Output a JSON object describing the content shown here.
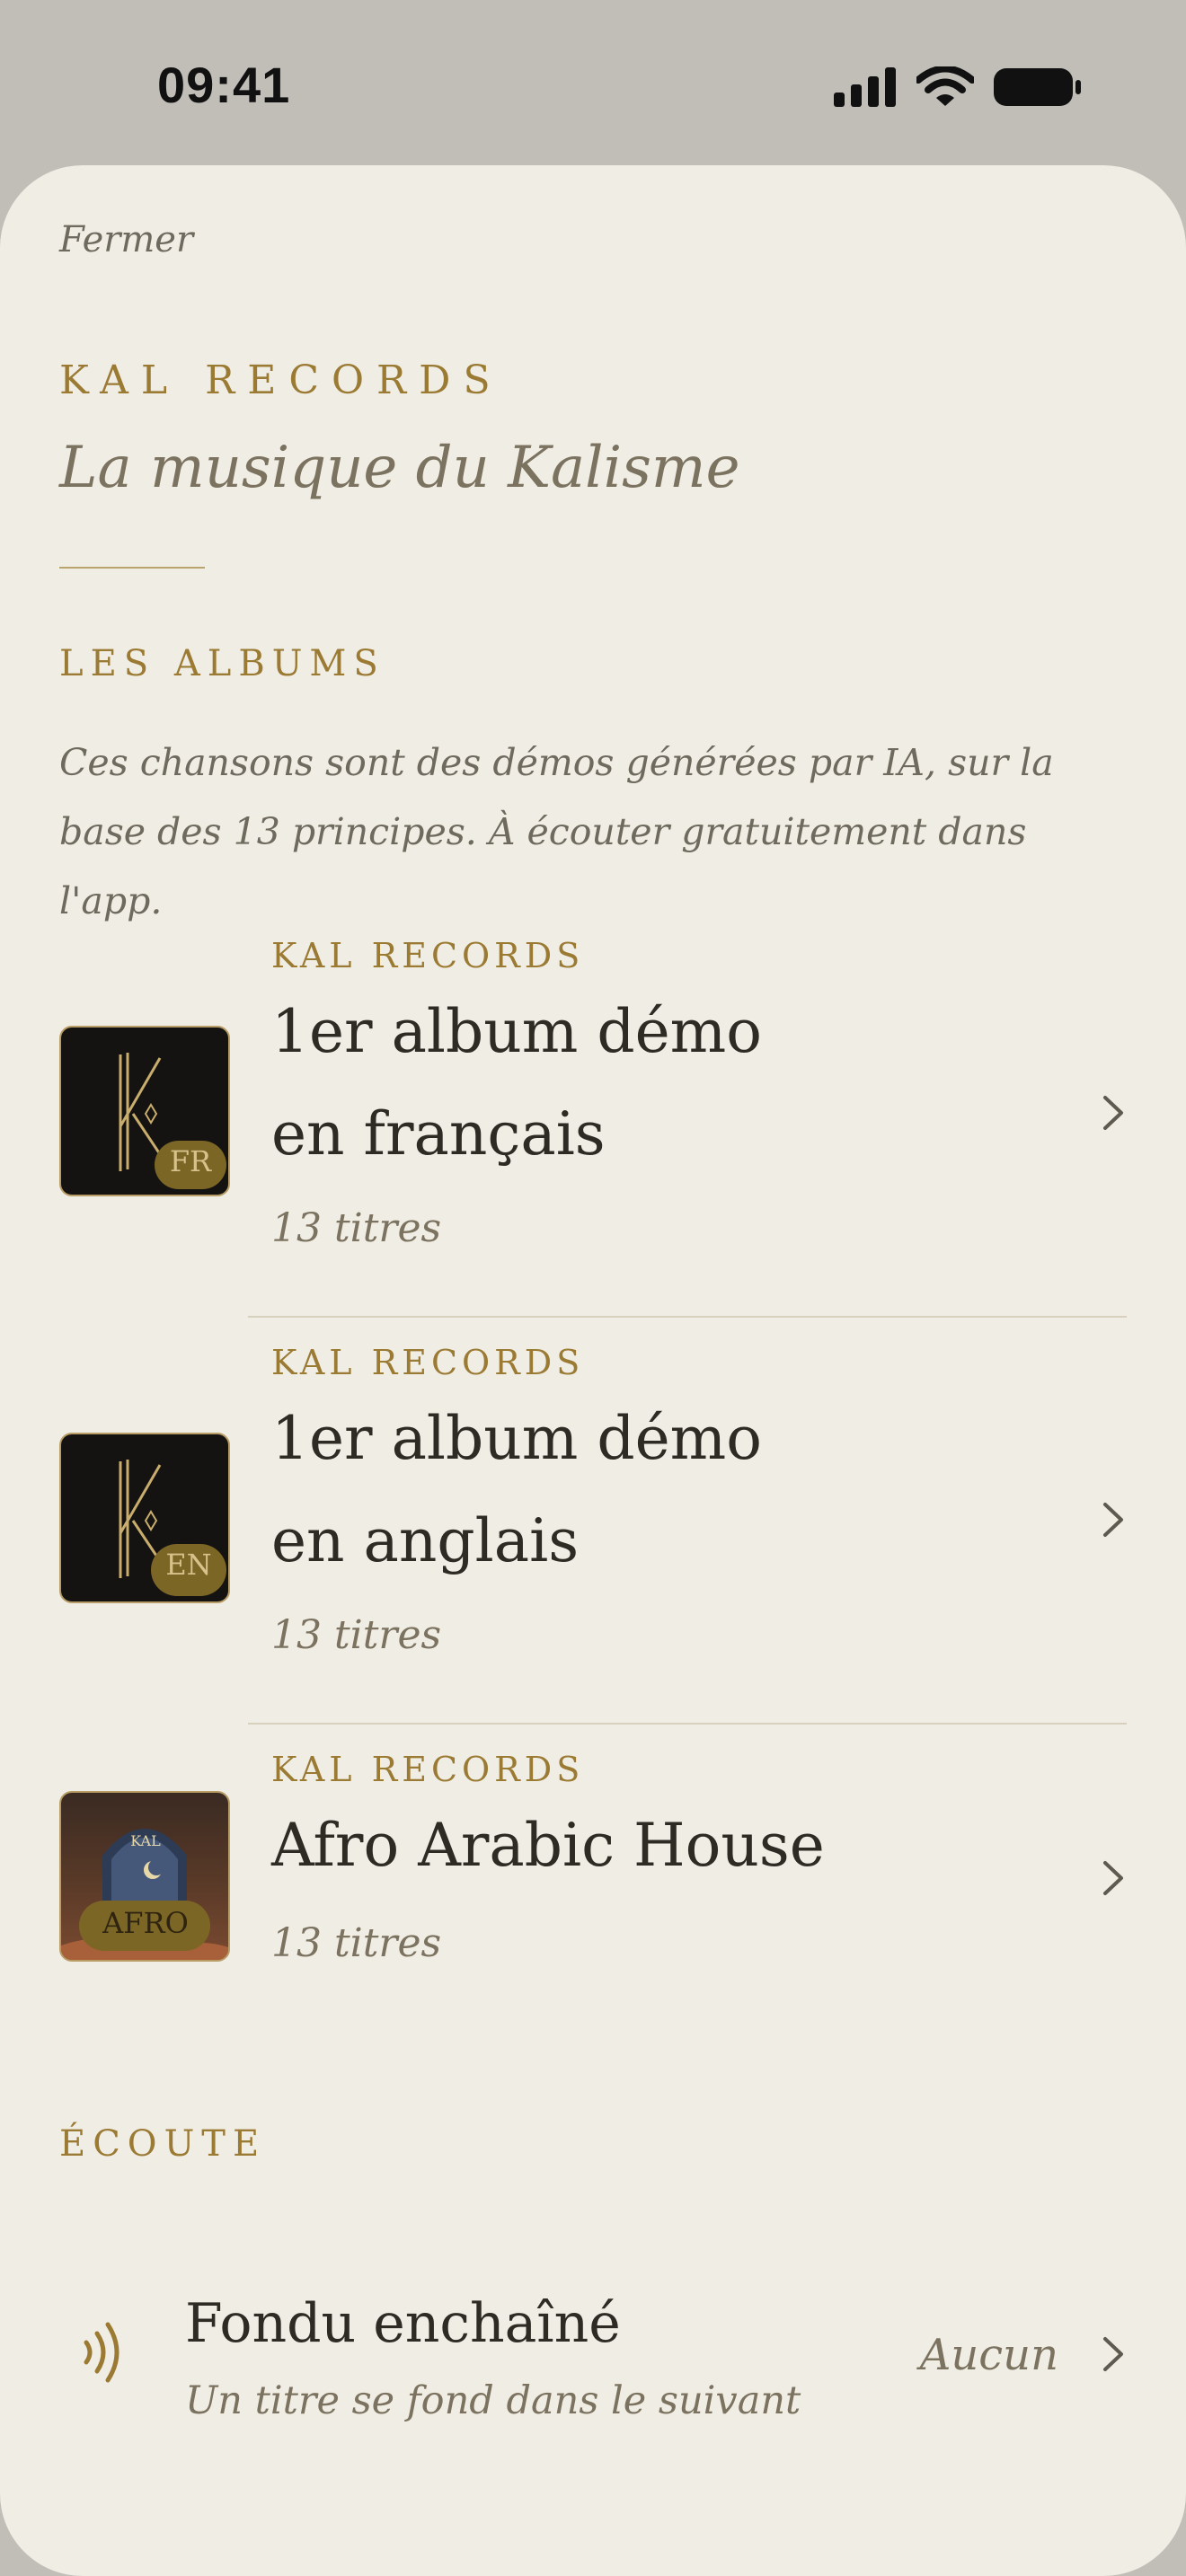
{
  "status_bar": {
    "time": "09:41"
  },
  "header": {
    "close_label": "Fermer",
    "brand": "KAL RECORDS",
    "subtitle": "La musique du Kalisme"
  },
  "albums_section": {
    "heading": "LES ALBUMS",
    "intro": "Ces chansons sont des démos générées par IA, sur la base des 13 principes. À écouter gratuitement dans l'app.",
    "albums": [
      {
        "label": "KAL RECORDS",
        "title_line1": "1er album démo",
        "title_line2": "en français",
        "count": "13 titres",
        "badge": "FR",
        "cover_mark": ""
      },
      {
        "label": "KAL RECORDS",
        "title_line1": "1er album démo",
        "title_line2": "en anglais",
        "count": "13 titres",
        "badge": "EN",
        "cover_mark": ""
      },
      {
        "label": "KAL RECORDS",
        "title_line1": "Afro Arabic House",
        "title_line2": "",
        "count": "13 titres",
        "badge": "AFRO",
        "cover_mark": "KAL"
      }
    ]
  },
  "listening_section": {
    "heading": "ÉCOUTE",
    "crossfade": {
      "title": "Fondu enchaîné",
      "description": "Un titre se fond dans le suivant",
      "value": "Aucun"
    }
  },
  "colors": {
    "gold": "#9b7b34",
    "sheet": "#f0ede5",
    "backdrop": "#c1beb8"
  },
  "icons": [
    "signal-icon",
    "wifi-icon",
    "battery-icon",
    "chevron-right-icon",
    "sound-waves-icon"
  ]
}
